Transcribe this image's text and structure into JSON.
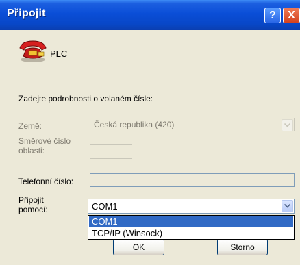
{
  "window": {
    "title": "Připojit"
  },
  "titlebar": {
    "help_glyph": "?",
    "close_glyph": "X"
  },
  "header": {
    "icon": "phone-icon",
    "name": "PLC"
  },
  "form": {
    "instructions": "Zadejte podrobnosti o volaném čísle:",
    "country_label": "Země:",
    "country_value": "Česká republika (420)",
    "area_code_label_line1": "Směrové číslo",
    "area_code_label_line2": "oblasti:",
    "area_code_value": "",
    "phone_label": "Telefonní číslo:",
    "phone_value": "",
    "connect_using_label_line1": "Připojit",
    "connect_using_label_line2": "pomocí:",
    "connect_using_value": "COM1",
    "connect_using_options": [
      "COM1",
      "TCP/IP (Winsock)"
    ]
  },
  "buttons": {
    "ok": "OK",
    "cancel": "Storno"
  },
  "colors": {
    "titlebar": "#0a4ed7",
    "selection": "#316ac5",
    "dialog_bg": "#ece9d8"
  }
}
